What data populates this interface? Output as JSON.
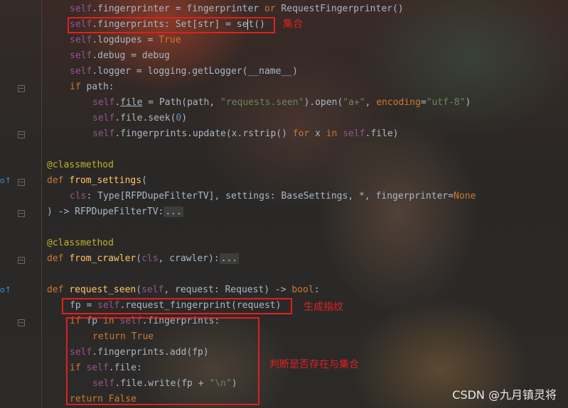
{
  "code": {
    "l1": {
      "self": "self",
      "a": ".fingerprinter = fingerprinter ",
      "or": "or",
      "b": " RequestFingerprinter()"
    },
    "l2": {
      "self": "self",
      "a": ".fingerprints: Set[str] = se",
      "b": "t()"
    },
    "l3": {
      "self": "self",
      "a": ".logdupes = ",
      "true": "True"
    },
    "l4": {
      "self": "self",
      "a": ".debug = debug"
    },
    "l5": {
      "self": "self",
      "a": ".logger = logging.getLogger(__name__)"
    },
    "l6": {
      "kw": "if",
      "a": " path:"
    },
    "l7": {
      "self": "self",
      "dot": ".",
      "file": "file",
      "a": " = Path(path, ",
      "s1": "\"requests.seen\"",
      "b": ").open(",
      "s2": "\"a+\"",
      "c": ", ",
      "enc": "encoding",
      "d": "=",
      "s3": "\"utf-8\"",
      "e": ")"
    },
    "l8": {
      "self": "self",
      "a": ".file.seek(",
      "num": "0",
      "b": ")"
    },
    "l9": {
      "self": "self",
      "a": ".fingerprints.update(x.rstrip() ",
      "for": "for",
      "b": " x ",
      "in": "in",
      "c": " ",
      "self2": "self",
      "d": ".file)"
    },
    "l10": {
      "dec": "@classmethod"
    },
    "l11": {
      "def": "def",
      "sp": " ",
      "fn": "from_settings",
      "a": "("
    },
    "l12": {
      "cls": "cls",
      "a": ": Type[RFPDupeFilterTV], settings: BaseSettings, *, fingerprinter=",
      "none": "None"
    },
    "l13": {
      "a": ") -> RFPDupeFilterTV:",
      "fold": "..."
    },
    "l14": {
      "dec": "@classmethod"
    },
    "l15": {
      "def": "def",
      "sp": " ",
      "fn": "from_crawler",
      "a": "(",
      "cls": "cls",
      "b": ", crawler):",
      "fold": "..."
    },
    "l16": {
      "def": "def",
      "sp": " ",
      "fn": "request_seen",
      "a": "(",
      "self": "self",
      "b": ", request: Request) -> ",
      "bool": "bool",
      "c": ":"
    },
    "l17": {
      "a": "fp = ",
      "self": "self",
      "b": ".request_fingerprint(request)"
    },
    "l18": {
      "kw": "if",
      "a": " fp ",
      "in": "in",
      "b": " ",
      "self": "self",
      "c": ".fingerprints:"
    },
    "l19": {
      "ret": "return",
      "sp": " ",
      "true": "True"
    },
    "l20": {
      "self": "self",
      "a": ".fingerprints.add(fp)"
    },
    "l21": {
      "kw": "if",
      "b": " ",
      "self": "self",
      "a": ".file:"
    },
    "l22": {
      "self": "self",
      "a": ".file.write(fp + ",
      "s": "\"\\n\"",
      "b": ")"
    },
    "l23": {
      "ret": "return",
      "sp": " ",
      "false": "False"
    }
  },
  "annotations": {
    "set_label": "集合",
    "fingerprint_label": "生成指纹",
    "check_label": "判断是否存在与集合"
  },
  "gutter_icons": {
    "override1": "o↑",
    "override2": "o↑"
  },
  "watermark": "CSDN @九月镇灵将"
}
